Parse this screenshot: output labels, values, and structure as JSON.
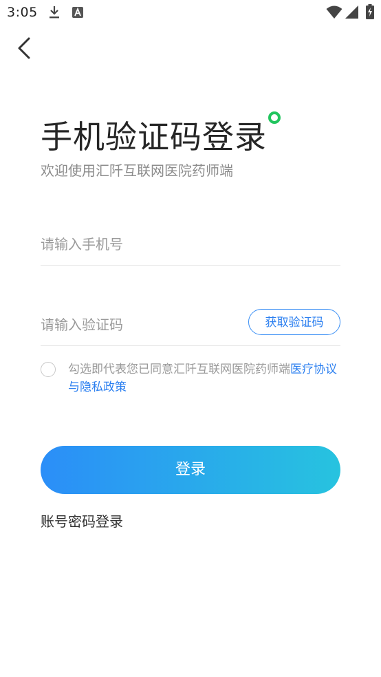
{
  "status_bar": {
    "time": "3:05",
    "left_icons": [
      "download-icon",
      "a-notification-icon"
    ],
    "right_icons": [
      "wifi-icon",
      "signal-icon",
      "battery-charging-icon"
    ]
  },
  "header": {
    "back_icon": "back-arrow-icon"
  },
  "title": "手机验证码登录",
  "subtitle": "欢迎使用汇阡互联网医院药师端",
  "phone": {
    "placeholder": "请输入手机号",
    "value": ""
  },
  "code": {
    "placeholder": "请输入验证码",
    "value": "",
    "button_label": "获取验证码"
  },
  "agreement": {
    "checked": false,
    "text": "勾选即代表您已同意汇阡互联网医院药师端",
    "link_text": "医疗协议与隐私政策"
  },
  "login_button": "登录",
  "alt_login": "账号密码登录",
  "colors": {
    "accent": "#2b7ff0",
    "gradient_start": "#2b8ef8",
    "gradient_end": "#27c3df",
    "dot": "#22c55e"
  }
}
